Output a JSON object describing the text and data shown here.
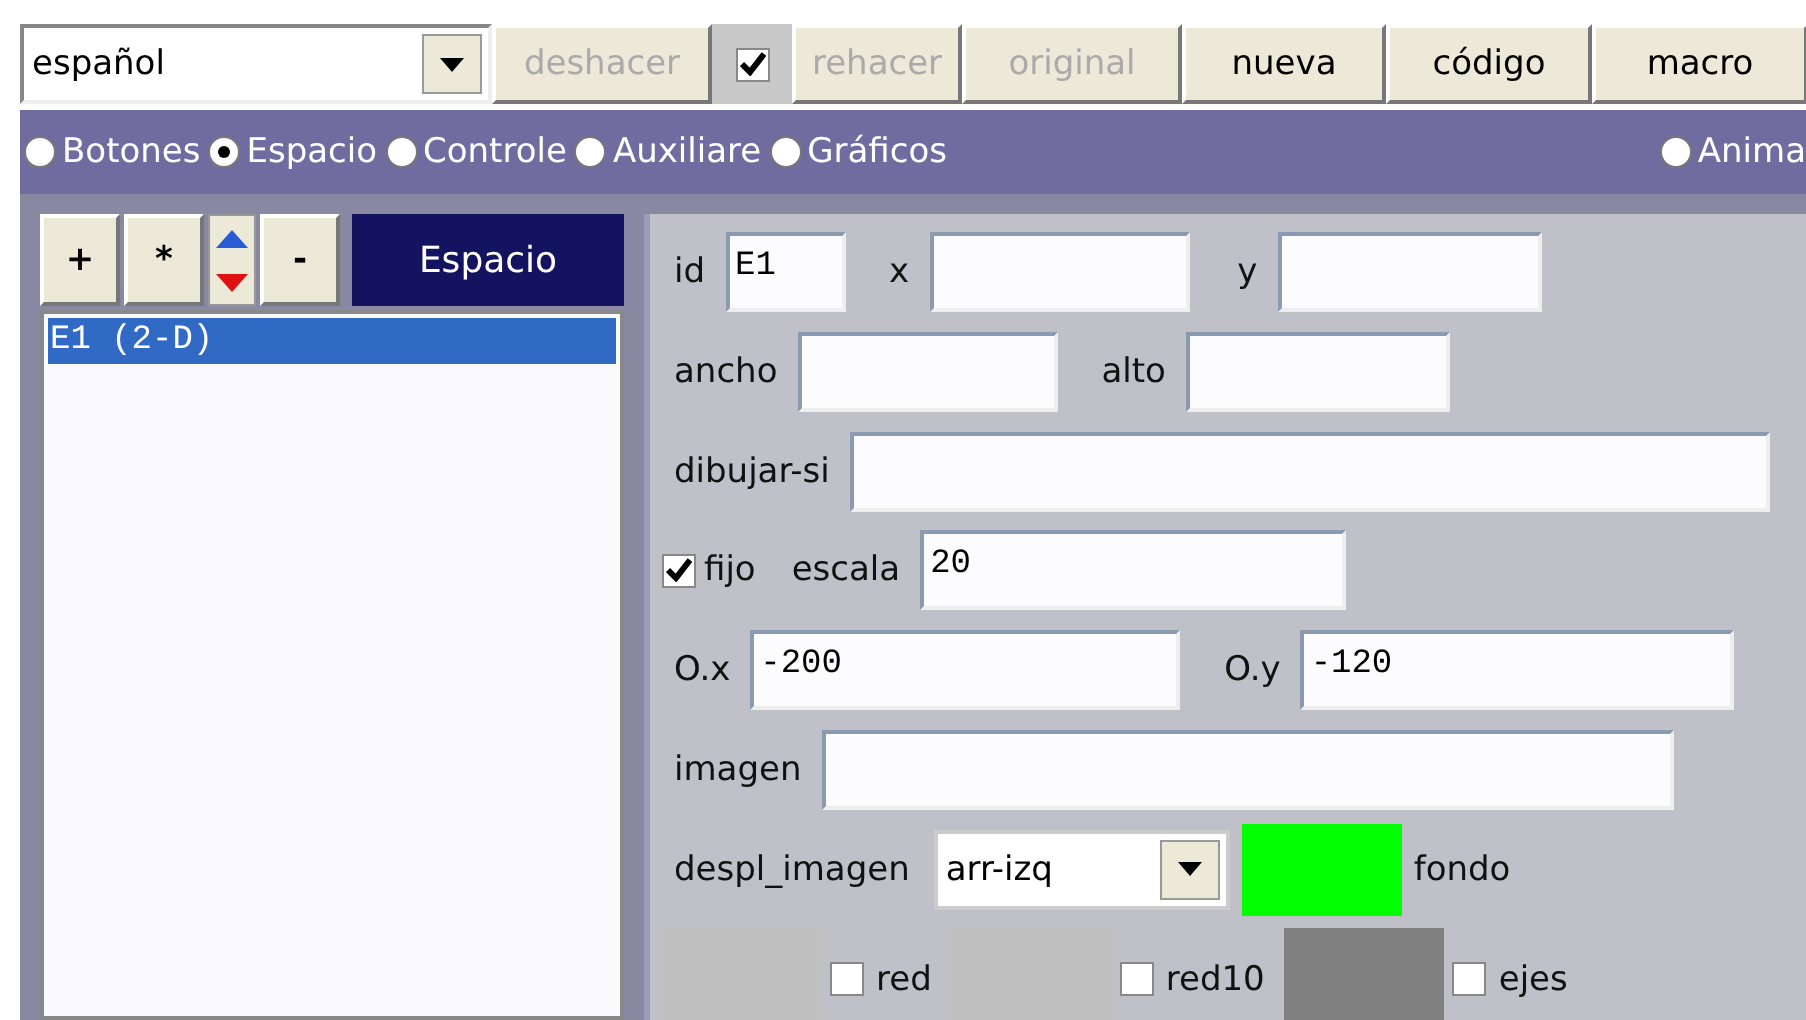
{
  "language_select": {
    "value": "español"
  },
  "toolbar": [
    {
      "kind": "button",
      "label": "deshacer",
      "disabled": true
    },
    {
      "kind": "checkbox",
      "checked": true
    },
    {
      "kind": "button",
      "label": "rehacer",
      "disabled": true
    },
    {
      "kind": "button",
      "label": "original",
      "disabled": true
    },
    {
      "kind": "button",
      "label": "nueva",
      "disabled": false
    },
    {
      "kind": "button",
      "label": "código",
      "disabled": false
    },
    {
      "kind": "button",
      "label": "macro",
      "disabled": false
    }
  ],
  "sections": [
    {
      "label": "Botones",
      "selected": false
    },
    {
      "label": "Espacio",
      "selected": true
    },
    {
      "label": "Controle",
      "selected": false
    },
    {
      "label": "Auxiliare",
      "selected": false
    },
    {
      "label": "Gráficos",
      "selected": false
    },
    {
      "label": "Anima",
      "selected": false
    }
  ],
  "element_panel": {
    "tools": [
      "+",
      "*",
      "-"
    ],
    "title": "Espacio",
    "items": [
      {
        "label": "E1 (2-D)",
        "selected": true
      }
    ]
  },
  "properties": {
    "id": {
      "label": "id",
      "value": "E1"
    },
    "x": {
      "label": "x"
    },
    "y": {
      "label": "y"
    },
    "ancho": {
      "label": "ancho"
    },
    "alto": {
      "label": "alto"
    },
    "dibujar_si": {
      "label": "dibujar-si"
    },
    "fijo": {
      "label": "fijo",
      "checked": true
    },
    "escala": {
      "label": "escala",
      "value": "20"
    },
    "ox": {
      "label": "O.x",
      "value": "-200"
    },
    "oy": {
      "label": "O.y",
      "value": "-120"
    },
    "imagen": {
      "label": "imagen"
    },
    "despl_imagen": {
      "label": "despl_imagen",
      "value": "arr-izq"
    },
    "fondo": {
      "label": "fondo",
      "color": "#00ff00"
    },
    "toggles": [
      {
        "label": "red",
        "checked": false,
        "color": "#c0c0c0"
      },
      {
        "label": "red10",
        "checked": false,
        "color": "#c0c0c0"
      },
      {
        "label": "ejes",
        "checked": false,
        "color": "#808080"
      }
    ]
  }
}
